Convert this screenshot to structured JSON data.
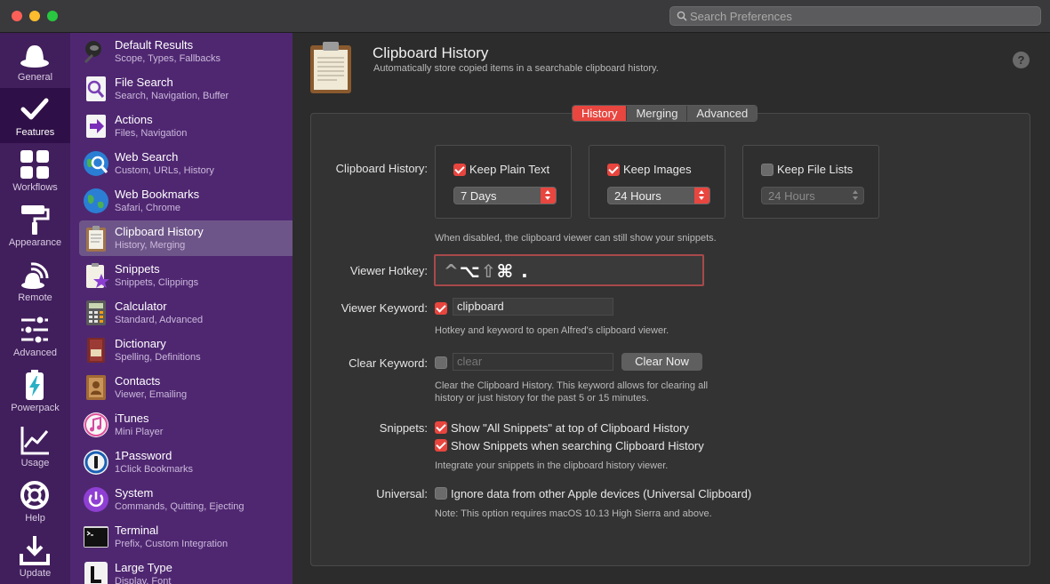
{
  "window": {
    "search_placeholder": "Search Preferences"
  },
  "categories": [
    {
      "label": "General",
      "icon": "hat-icon",
      "active": false
    },
    {
      "label": "Features",
      "icon": "checkmark-icon",
      "active": true
    },
    {
      "label": "Workflows",
      "icon": "workflows-grid-icon",
      "active": false
    },
    {
      "label": "Appearance",
      "icon": "paint-roller-icon",
      "active": false
    },
    {
      "label": "Remote",
      "icon": "remote-signal-icon",
      "active": false
    },
    {
      "label": "Advanced",
      "icon": "sliders-icon",
      "active": false
    },
    {
      "label": "Powerpack",
      "icon": "battery-bolt-icon",
      "active": false
    },
    {
      "label": "Usage",
      "icon": "usage-chart-icon",
      "active": false
    },
    {
      "label": "Help",
      "icon": "lifebuoy-icon",
      "active": false
    },
    {
      "label": "Update",
      "icon": "download-icon",
      "active": false
    }
  ],
  "features": [
    {
      "name": "Default Results",
      "sub": "Scope, Types, Fallbacks",
      "icon": "default-results-icon",
      "active": false
    },
    {
      "name": "File Search",
      "sub": "Search, Navigation, Buffer",
      "icon": "file-search-icon",
      "active": false
    },
    {
      "name": "Actions",
      "sub": "Files, Navigation",
      "icon": "actions-icon",
      "active": false
    },
    {
      "name": "Web Search",
      "sub": "Custom, URLs, History",
      "icon": "web-search-icon",
      "active": false
    },
    {
      "name": "Web Bookmarks",
      "sub": "Safari, Chrome",
      "icon": "web-bookmarks-icon",
      "active": false
    },
    {
      "name": "Clipboard History",
      "sub": "History, Merging",
      "icon": "clipboard-icon",
      "active": true
    },
    {
      "name": "Snippets",
      "sub": "Snippets, Clippings",
      "icon": "snippets-icon",
      "active": false
    },
    {
      "name": "Calculator",
      "sub": "Standard, Advanced",
      "icon": "calculator-icon",
      "active": false
    },
    {
      "name": "Dictionary",
      "sub": "Spelling, Definitions",
      "icon": "dictionary-icon",
      "active": false
    },
    {
      "name": "Contacts",
      "sub": "Viewer, Emailing",
      "icon": "contacts-icon",
      "active": false
    },
    {
      "name": "iTunes",
      "sub": "Mini Player",
      "icon": "itunes-icon",
      "active": false
    },
    {
      "name": "1Password",
      "sub": "1Click Bookmarks",
      "icon": "1password-icon",
      "active": false
    },
    {
      "name": "System",
      "sub": "Commands, Quitting, Ejecting",
      "icon": "system-power-icon",
      "active": false
    },
    {
      "name": "Terminal",
      "sub": "Prefix, Custom Integration",
      "icon": "terminal-icon",
      "active": false
    },
    {
      "name": "Large Type",
      "sub": "Display, Font",
      "icon": "large-type-icon",
      "active": false
    }
  ],
  "header": {
    "title": "Clipboard History",
    "subtitle": "Automatically store copied items in a searchable clipboard history.",
    "help": "?"
  },
  "tabs": [
    {
      "label": "History",
      "active": true
    },
    {
      "label": "Merging",
      "active": false
    },
    {
      "label": "Advanced",
      "active": false
    }
  ],
  "history": {
    "label": "Clipboard History:",
    "plain_text": {
      "label": "Keep Plain Text",
      "checked": true,
      "duration": "7 Days"
    },
    "images": {
      "label": "Keep Images",
      "checked": true,
      "duration": "24 Hours"
    },
    "file_lists": {
      "label": "Keep File Lists",
      "checked": false,
      "duration": "24 Hours"
    },
    "note": "When disabled, the clipboard viewer can still show your snippets."
  },
  "hotkey": {
    "label": "Viewer Hotkey:",
    "dim_keys": "^",
    "keys": "⌥",
    "dim_keys2": "⇧",
    "keys2": "⌘ ."
  },
  "keyword": {
    "label": "Viewer Keyword:",
    "checked": true,
    "value": "clipboard",
    "note": "Hotkey and keyword to open Alfred's clipboard viewer."
  },
  "clear": {
    "label": "Clear Keyword:",
    "checked": false,
    "value": "clear",
    "button": "Clear Now",
    "note_line1": "Clear the Clipboard History. This keyword allows for clearing all",
    "note_line2": "history or just history for the past 5 or 15 minutes."
  },
  "snippets": {
    "label": "Snippets:",
    "opt1": "Show \"All Snippets\" at top of Clipboard History",
    "opt2": "Show Snippets when searching Clipboard History",
    "note": "Integrate your snippets in the clipboard history viewer."
  },
  "universal": {
    "label": "Universal:",
    "opt": "Ignore data from other Apple devices (Universal Clipboard)",
    "checked": false,
    "note": "Note: This option requires macOS 10.13 High Sierra and above."
  },
  "colors": {
    "accent": "#e8463f",
    "sidebar_dark": "#411e5c",
    "sidebar_list": "#4f2771",
    "selected_item": "#6e5589"
  }
}
